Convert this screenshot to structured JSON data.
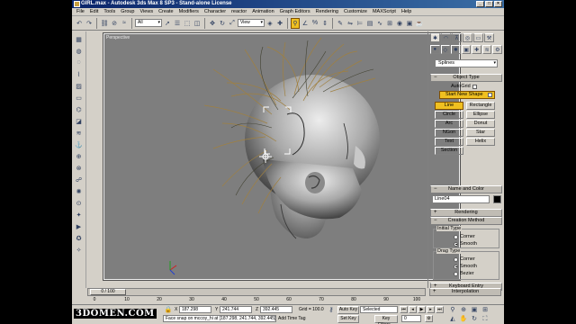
{
  "window": {
    "title": "GIRL.max - Autodesk 3ds Max 8 SP3 - Stand-alone License",
    "minimize": "_",
    "maximize": "□",
    "close": "×"
  },
  "menu": [
    "File",
    "Edit",
    "Tools",
    "Group",
    "Views",
    "Create",
    "Modifiers",
    "Character",
    "reactor",
    "Animation",
    "Graph Editors",
    "Rendering",
    "Customize",
    "MAXScript",
    "Help"
  ],
  "toolbar": {
    "selection_filter": "All",
    "reference_coord": "View"
  },
  "viewport": {
    "label": "Perspective"
  },
  "command_panel": {
    "category": "Splines",
    "object_type_title": "Object Type",
    "autogrid_label": "AutoGrid",
    "start_new_shape": "Start New Shape",
    "buttons": [
      "Line",
      "Rectangle",
      "Circle",
      "Ellipse",
      "Arc",
      "Donut",
      "NGon",
      "Star",
      "Text",
      "Helix",
      "Section"
    ],
    "name_color_title": "Name and Color",
    "object_name": "Line04",
    "rendering_title": "Rendering",
    "creation_method_title": "Creation Method",
    "initial_type_title": "Initial Type",
    "initial_type_options": [
      "Corner",
      "Smooth"
    ],
    "drag_type_title": "Drag Type",
    "drag_type_options": [
      "Corner",
      "Smooth",
      "Bezier"
    ],
    "keyboard_entry_title": "Keyboard Entry",
    "interpolation_title": "Interpolation",
    "accent_color": "#f0c020"
  },
  "timeline": {
    "frame_display": "0 / 100",
    "ticks": [
      "0",
      "10",
      "20",
      "30",
      "40",
      "50",
      "60",
      "70",
      "80",
      "90",
      "100"
    ]
  },
  "status": {
    "coord_x_label": "X",
    "coord_x": "187.298",
    "coord_y_label": "Y",
    "coord_y": "241.744",
    "coord_z_label": "Z",
    "coord_z": "392.445",
    "grid": "Grid = 100.0",
    "prompt": "Face snap on mccoy_hi at [187.298, 241.744, 392.445]",
    "add_time_tag": "Add Time Tag",
    "auto_key": "Auto Key",
    "set_key": "Set Key",
    "key_mode": "Selected",
    "key_filters": "Key Filters...",
    "frame": "0"
  },
  "watermark": "3DOMEN.COM"
}
